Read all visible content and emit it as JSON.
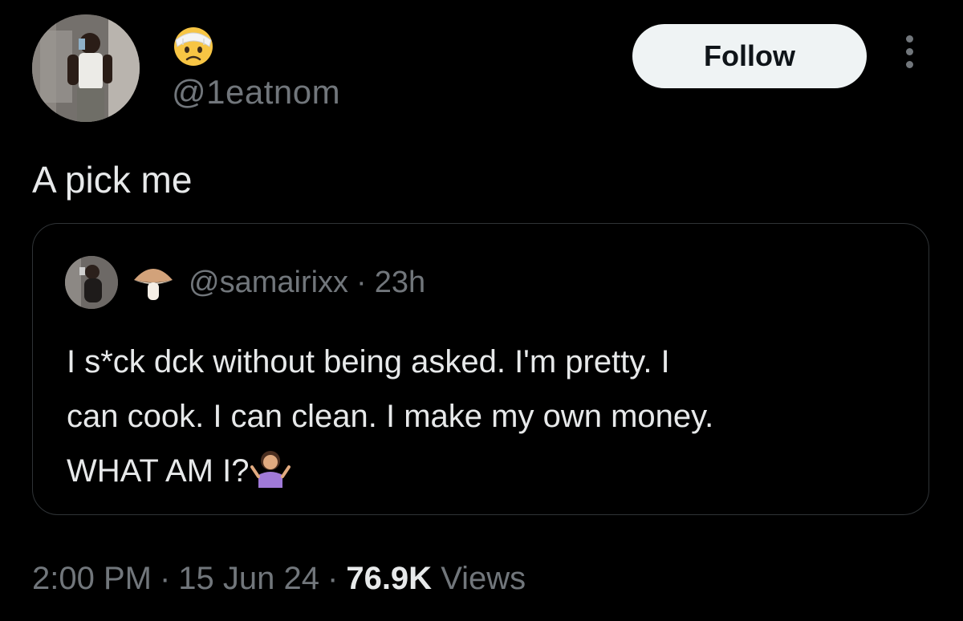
{
  "author": {
    "display_name_icon": "head-bandage-emoji",
    "handle": "@1eatnom",
    "follow_label": "Follow",
    "more_icon": "more-dots-icon"
  },
  "tweet": {
    "text": "A pick me"
  },
  "quoted": {
    "name_icon": "mushroom-emoji",
    "handle": "@samairixx",
    "separator": "·",
    "age": "23h",
    "lines": [
      "I s*ck dck without being asked. I'm pretty. I",
      "can cook. I can clean. I make my own money.",
      "WHAT AM I?"
    ],
    "trailing_icon": "person-shrugging-emoji"
  },
  "footer": {
    "time": "2:00 PM",
    "separator": "·",
    "date": "15 Jun 24",
    "views_count": "76.9K",
    "views_label": "Views"
  },
  "colors": {
    "background": "#000000",
    "primary_text": "#e7e9ea",
    "secondary_text": "#71767b",
    "border": "#2f3336",
    "follow_bg": "#eff3f4",
    "follow_text": "#0f1419"
  }
}
